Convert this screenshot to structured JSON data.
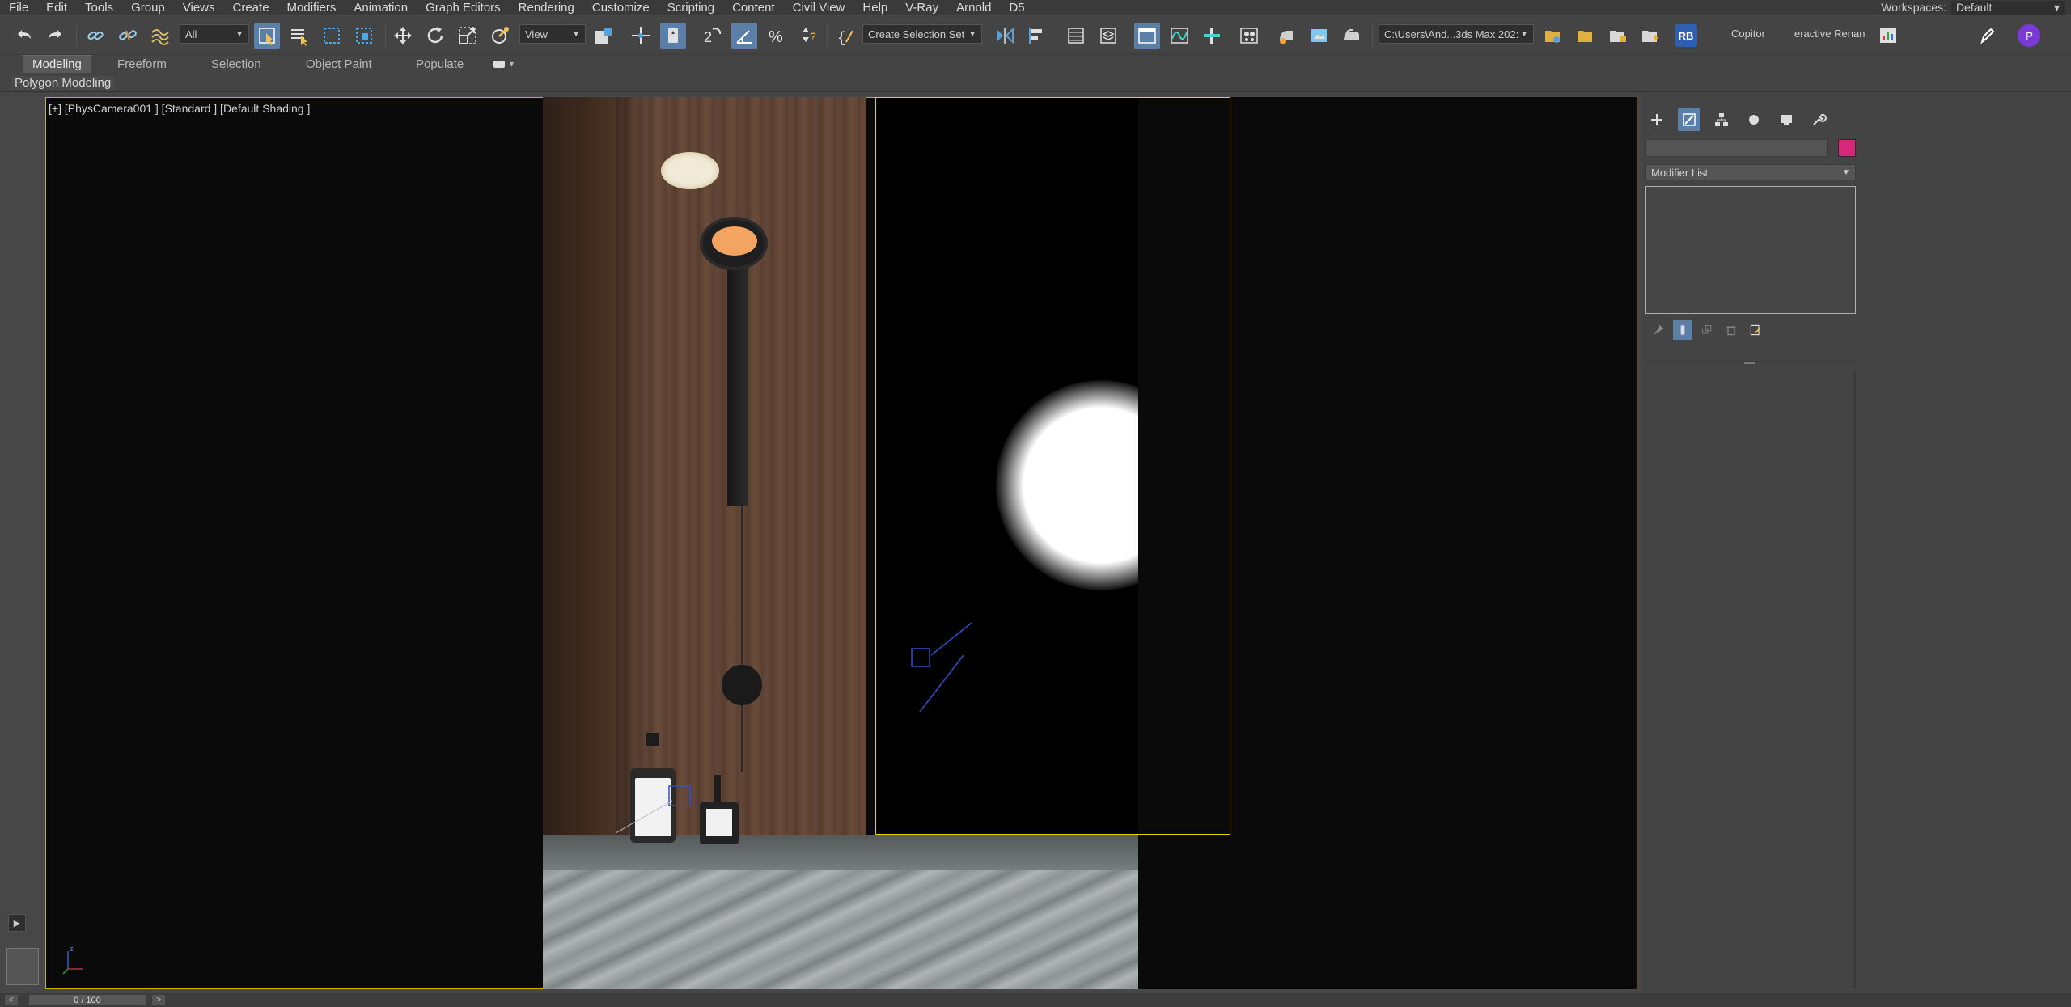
{
  "menu": [
    "File",
    "Edit",
    "Tools",
    "Group",
    "Views",
    "Create",
    "Modifiers",
    "Animation",
    "Graph Editors",
    "Rendering",
    "Customize",
    "Scripting",
    "Content",
    "Civil View",
    "Help",
    "V-Ray",
    "Arnold",
    "D5"
  ],
  "workspace": {
    "label": "Workspaces:",
    "value": "Default"
  },
  "toolbar": {
    "selection_filter": "All",
    "ref_coord": "View",
    "named_selection": "Create Selection Set",
    "project_path": "C:\\Users\\And...3ds Max 202:",
    "rb_badge": "RB",
    "copitor": "Copitor",
    "interactive_render": "eractive Renan",
    "profile_badge": "P"
  },
  "ribbon": {
    "tabs": [
      "Modeling",
      "Freeform",
      "Selection",
      "Object Paint",
      "Populate"
    ],
    "active_tab": "Modeling",
    "sub_label": "Polygon Modeling"
  },
  "viewport": {
    "label": "[+] [PhysCamera001 ] [Standard ] [Default Shading ]",
    "axis_label": "z"
  },
  "command_panel": {
    "modifier_list": "Modifier List",
    "object_color": "#d6287a"
  },
  "timeslider": {
    "frame_text": "0 / 100"
  },
  "colors": {
    "accent_active": "#5b7fa6",
    "viewport_border": "#c8b400",
    "camera_frame": "#e6d400"
  },
  "icons": [
    "undo-icon",
    "redo-icon",
    "link-icon",
    "unlink-icon",
    "bind-spacewarp-icon",
    "select-object-icon",
    "select-by-name-icon",
    "rect-region-icon",
    "window-crossing-icon",
    "move-icon",
    "rotate-icon",
    "scale-icon",
    "place-icon",
    "pivot-icon",
    "keyboard-shortcut-icon",
    "snaps-toggle-icon",
    "angle-snap-icon",
    "percent-snap-icon",
    "spinner-snap-icon",
    "named-set-edit-icon",
    "mirror-icon",
    "align-icon",
    "scene-explorer-icon",
    "layer-explorer-icon",
    "toggle-ribbon-icon",
    "curve-editor-icon",
    "schematic-view-icon",
    "material-editor-icon",
    "render-setup-icon",
    "render-frame-icon",
    "render-icon"
  ]
}
